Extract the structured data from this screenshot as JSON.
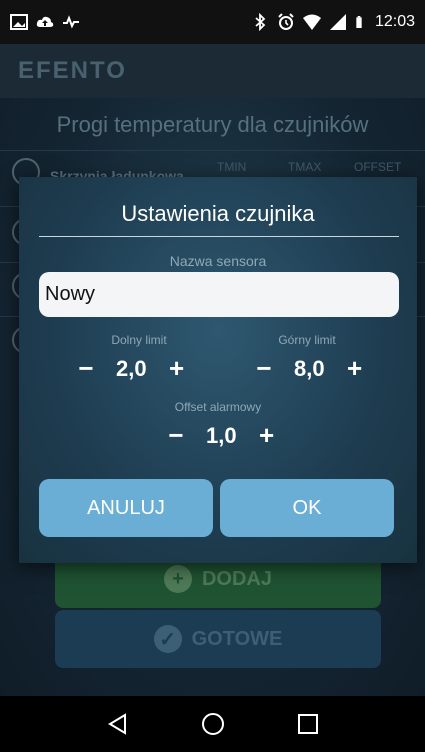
{
  "status_bar": {
    "time": "12:03",
    "icons_left": [
      "gallery-icon",
      "cloud-upload-icon",
      "pulse-icon"
    ],
    "icons_right": [
      "bluetooth-icon",
      "alarm-icon",
      "wifi-icon",
      "signal-icon",
      "battery-icon"
    ]
  },
  "app": {
    "brand": "EFENTO"
  },
  "background_screen": {
    "title": "Progi temperatury dla czujników",
    "first_row_name": "Skrzynia ładunkowa",
    "columns": [
      "TMIN",
      "TMAX",
      "OFFSET"
    ],
    "add_button": "DODAJ",
    "done_button": "GOTOWE"
  },
  "dialog": {
    "title": "Ustawienia czujnika",
    "name_label": "Nazwa sensora",
    "name_value": "Nowy",
    "lower_limit_label": "Dolny limit",
    "lower_limit_value": "2,0",
    "upper_limit_label": "Górny limit",
    "upper_limit_value": "8,0",
    "offset_label": "Offset alarmowy",
    "offset_value": "1,0",
    "minus": "−",
    "plus": "+",
    "cancel_button": "ANULUJ",
    "ok_button": "OK"
  },
  "colors": {
    "accent_blue": "#6aaed6",
    "add_green": "#1f5332",
    "done_blue": "#1b3c52"
  }
}
